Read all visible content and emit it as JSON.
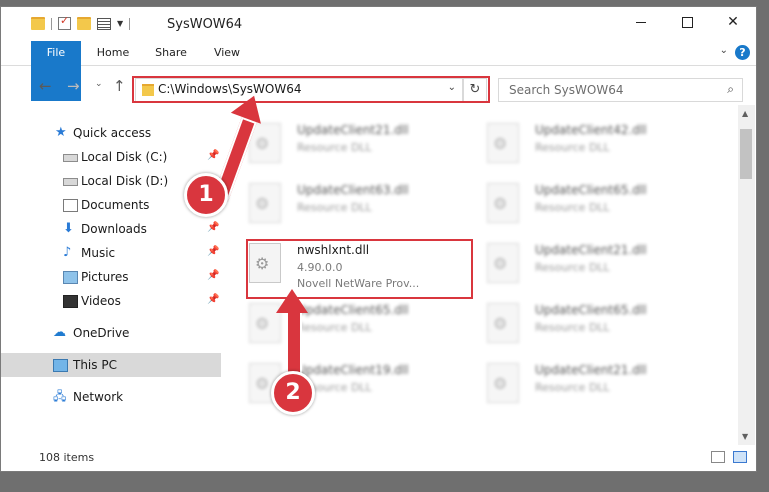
{
  "window": {
    "title": "SysWOW64"
  },
  "tabs": {
    "file": "File",
    "home": "Home",
    "share": "Share",
    "view": "View",
    "help": "?"
  },
  "address": {
    "path": "C:\\Windows\\SysWOW64"
  },
  "search": {
    "placeholder": "Search SysWOW64"
  },
  "sidebar": {
    "items": [
      {
        "label": "Quick access",
        "icon": "star-icon"
      },
      {
        "label": "Local Disk (C:)",
        "icon": "drive-icon",
        "pinned": true
      },
      {
        "label": "Local Disk (D:)",
        "icon": "drive-icon"
      },
      {
        "label": "Documents",
        "icon": "documents-icon"
      },
      {
        "label": "Downloads",
        "icon": "download-icon",
        "pinned": true
      },
      {
        "label": "Music",
        "icon": "music-icon",
        "pinned": true
      },
      {
        "label": "Pictures",
        "icon": "pictures-icon",
        "pinned": true
      },
      {
        "label": "Videos",
        "icon": "videos-icon",
        "pinned": true
      },
      {
        "label": "OneDrive",
        "icon": "cloud-icon"
      },
      {
        "label": "This PC",
        "icon": "computer-icon",
        "selected": true
      },
      {
        "label": "Network",
        "icon": "network-icon"
      }
    ]
  },
  "files": [
    {
      "name": "UpdateClient21.dll",
      "type": "Resource DLL"
    },
    {
      "name": "UpdateClient42.dll",
      "type": "Resource DLL"
    },
    {
      "name": "UpdateClient63.dll",
      "type": "Resource DLL"
    },
    {
      "name": "UpdateClient65.dll",
      "type": "Resource DLL"
    },
    {
      "name": "nwshlxnt.dll",
      "version": "4.90.0.0",
      "type": "Novell NetWare Prov..."
    },
    {
      "name": "UpdateClient21.dll",
      "type": "Resource DLL"
    },
    {
      "name": "UpdateClient65.dll",
      "type": "Resource DLL"
    },
    {
      "name": "UpdateClient65.dll",
      "type": "Resource DLL"
    },
    {
      "name": "UpdateClient19.dll",
      "type": "Resource DLL"
    },
    {
      "name": "UpdateClient21.dll",
      "type": "Resource DLL"
    }
  ],
  "status": {
    "count": "108 items"
  },
  "annotations": {
    "step1": "1",
    "step2": "2"
  },
  "colors": {
    "accent": "#1979ca",
    "highlight": "#d9363e"
  }
}
